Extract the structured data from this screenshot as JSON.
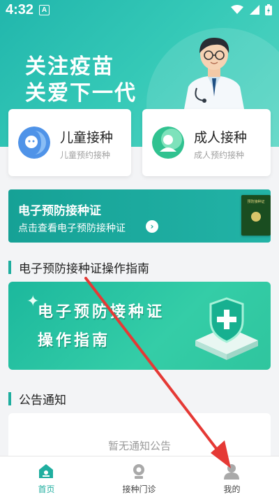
{
  "status_bar": {
    "time": "4:32",
    "notification_badge": "A"
  },
  "hero": {
    "line1": "关注疫苗",
    "line2": "关爱下一代"
  },
  "cards": [
    {
      "title": "儿童接种",
      "subtitle": "儿童预约接种",
      "icon": "child-icon"
    },
    {
      "title": "成人接种",
      "subtitle": "成人预约接种",
      "icon": "adult-icon"
    }
  ],
  "certificate": {
    "title": "电子预防接种证",
    "subtitle": "点击查看电子预防接种证",
    "book_title": "预防接种证"
  },
  "guide_section": {
    "heading": "电子预防接种证操作指南"
  },
  "guide_banner": {
    "line1": "电子预防接种证",
    "line2": "操作指南"
  },
  "notice_section": {
    "heading": "公告通知",
    "empty_text": "暂无通知公告"
  },
  "tabs": [
    {
      "label": "首页",
      "active": true
    },
    {
      "label": "接种门诊",
      "active": false
    },
    {
      "label": "我的",
      "active": false
    }
  ],
  "colors": {
    "primary": "#1fae9f",
    "hero": "#2dc0b1",
    "annotation_arrow": "#e53935"
  }
}
